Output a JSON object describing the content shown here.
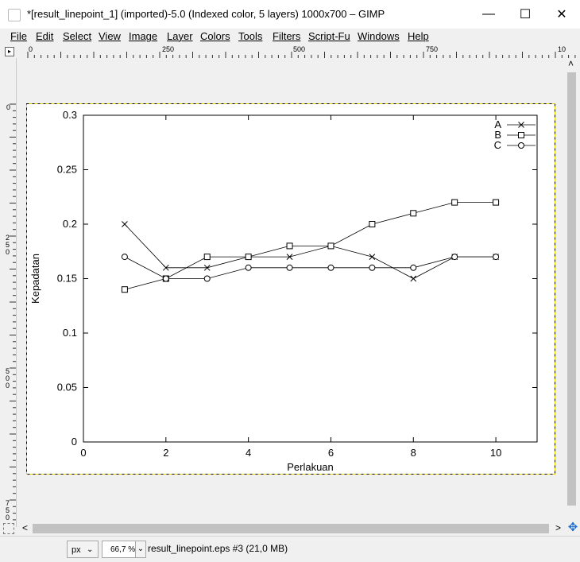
{
  "window": {
    "title": "*[result_linepoint_1] (imported)-5.0 (Indexed color, 5 layers) 1000x700 – GIMP",
    "minimize_glyph": "—",
    "maximize_glyph": "☐",
    "close_glyph": "✕"
  },
  "menu": [
    "File",
    "Edit",
    "Select",
    "View",
    "Image",
    "Layer",
    "Colors",
    "Tools",
    "Filters",
    "Script-Fu",
    "Windows",
    "Help"
  ],
  "ruler_top": {
    "labels": [
      "0",
      "250",
      "500",
      "750",
      "10"
    ],
    "corner_glyph": "▸"
  },
  "ruler_left": {
    "labels": [
      "0",
      "250",
      "500",
      "750"
    ]
  },
  "statusbar": {
    "unit": "px",
    "zoom": "66,7 %",
    "info": "result_linepoint.eps #3 (21,0 MB)"
  },
  "scroll": {
    "left_arrow": "<",
    "right_arrow": ">",
    "up_arrow": "˄",
    "down_arrow": "˅"
  },
  "chart_data": {
    "type": "line",
    "xlabel": "Perlakuan",
    "ylabel": "Kepadatan",
    "xlim": [
      0,
      11
    ],
    "ylim": [
      0,
      0.3
    ],
    "x_ticks": [
      "0",
      "2",
      "4",
      "6",
      "8",
      "10"
    ],
    "y_ticks": [
      "0",
      "0.05",
      "0.1",
      "0.15",
      "0.2",
      "0.25",
      "0.3"
    ],
    "legend_position": "top-right",
    "x": [
      1,
      2,
      3,
      4,
      5,
      6,
      7,
      8,
      9,
      10
    ],
    "series": [
      {
        "name": "A",
        "marker": "x",
        "values": [
          0.2,
          0.16,
          0.16,
          0.17,
          0.17,
          0.18,
          0.17,
          0.15,
          0.17,
          0.17
        ]
      },
      {
        "name": "B",
        "marker": "square",
        "values": [
          0.14,
          0.15,
          0.17,
          0.17,
          0.18,
          0.18,
          0.2,
          0.21,
          0.22,
          0.22
        ]
      },
      {
        "name": "C",
        "marker": "circle",
        "values": [
          0.17,
          0.15,
          0.15,
          0.16,
          0.16,
          0.16,
          0.16,
          0.16,
          0.17,
          0.17
        ]
      }
    ]
  }
}
